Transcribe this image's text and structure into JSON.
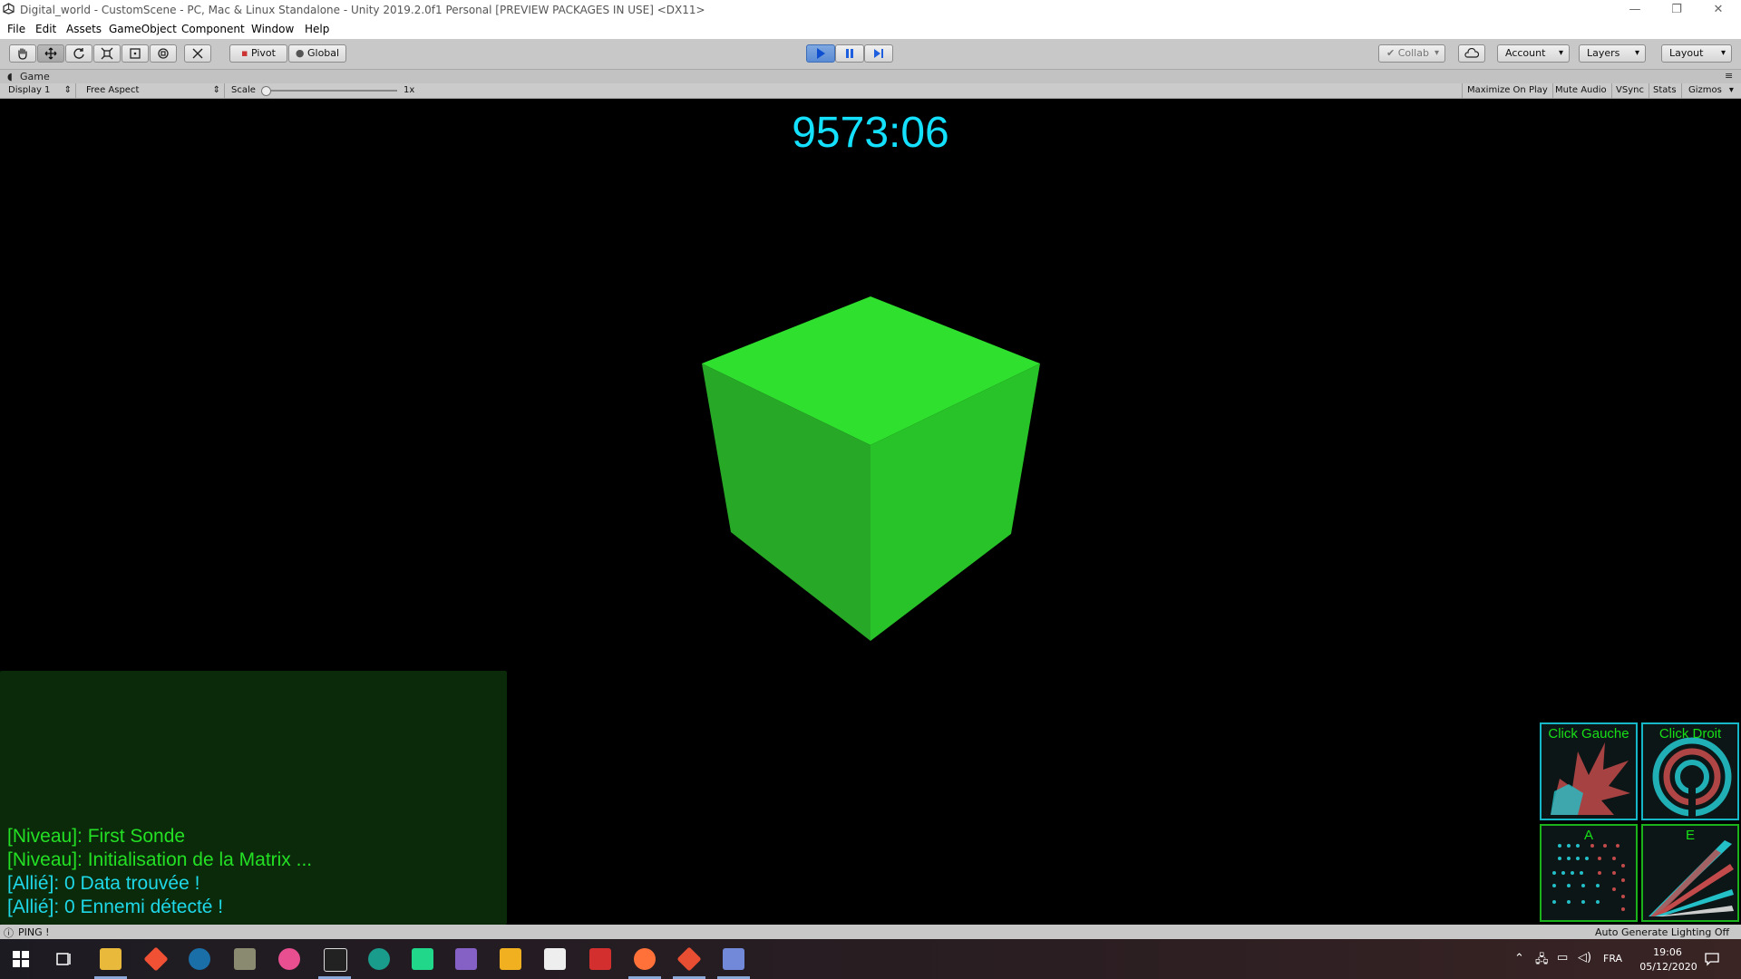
{
  "window": {
    "title": "Digital_world - CustomScene - PC, Mac & Linux Standalone - Unity 2019.2.0f1 Personal [PREVIEW PACKAGES IN USE] <DX11>",
    "minimize": "—",
    "maximize": "❐",
    "close": "✕"
  },
  "menu": [
    "File",
    "Edit",
    "Assets",
    "GameObject",
    "Component",
    "Window",
    "Help"
  ],
  "toolbar": {
    "pivot": "Pivot",
    "global": "Global",
    "collab": "Collab",
    "account": "Account",
    "layers": "Layers",
    "layout": "Layout"
  },
  "game_tab": {
    "label": "Game"
  },
  "game_bar": {
    "display": "Display 1",
    "aspect": "Free Aspect",
    "scale_label": "Scale",
    "scale_value": "1x",
    "maximize_on_play": "Maximize On Play",
    "mute_audio": "Mute Audio",
    "vsync": "VSync",
    "stats": "Stats",
    "gizmos": "Gizmos"
  },
  "game": {
    "timer": "9573:06",
    "cube_colors": {
      "top": "#2fe02f",
      "left": "#27a827",
      "right": "#28c328"
    },
    "log": [
      {
        "text": "[Niveau]: First Sonde",
        "color": "#24e024"
      },
      {
        "text": "[Niveau]: Initialisation de la Matrix ...",
        "color": "#24e024"
      },
      {
        "text": "[Allié]: 0 Data trouvée !",
        "color": "#1fd8e8"
      },
      {
        "text": "[Allié]: 0 Ennemi détecté !",
        "color": "#1fd8e8"
      }
    ],
    "skills": {
      "left_click": "Click Gauche",
      "right_click": "Click Droit",
      "key_a": "A",
      "key_e": "E"
    },
    "accent_cyan": "#16b8c8",
    "accent_green": "#1bb31b"
  },
  "status": {
    "message": "PING !",
    "lighting": "Auto Generate Lighting Off"
  },
  "taskbar": {
    "language": "FRA",
    "time": "19:06",
    "date": "05/12/2020"
  }
}
